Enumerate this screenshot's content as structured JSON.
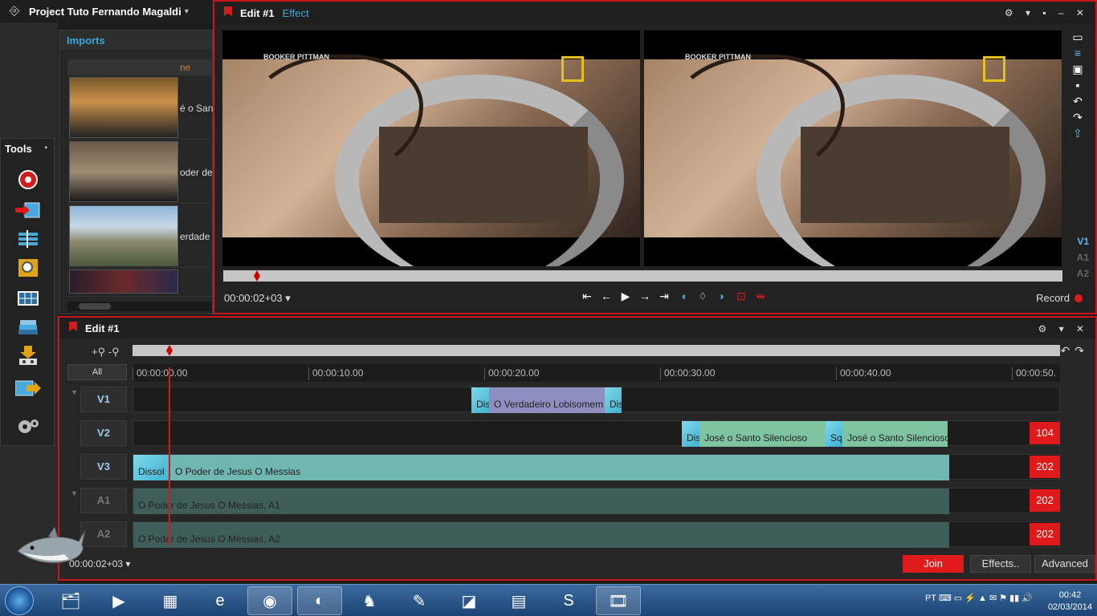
{
  "project": {
    "title": "Project Tuto Fernando Magaldi",
    "caret": "▾",
    "exit_icon": "exit-icon"
  },
  "imports": {
    "title": "Imports",
    "col_header": "ne",
    "items": [
      {
        "label": "é o San"
      },
      {
        "label": "oder de"
      },
      {
        "label": "erdade"
      },
      {
        "label": ""
      }
    ]
  },
  "tools": {
    "title": "Tools",
    "pin": "▪"
  },
  "viewer": {
    "title": "Edit #1",
    "subtitle": "Effect",
    "watermark": "BOOKER PITTMAN",
    "timecode": "00:00:02+03",
    "timecode_caret": "▾",
    "record_label": "Record",
    "tracks": [
      "V1",
      "A1",
      "A2"
    ]
  },
  "timeline": {
    "title": "Edit #1",
    "zoom_in": "+",
    "zoom_out": "-",
    "all_label": "All",
    "ruler": [
      "00:00:00.00",
      "00:00:10.00",
      "00:00:20.00",
      "00:00:30.00",
      "00:00:40.00",
      "00:00:50."
    ],
    "tracks": [
      {
        "name": "V1",
        "badge": ""
      },
      {
        "name": "V2",
        "badge": "104"
      },
      {
        "name": "V3",
        "badge": "202"
      },
      {
        "name": "A1",
        "badge": "202"
      },
      {
        "name": "A2",
        "badge": "202"
      }
    ],
    "clips": {
      "v1_t1": "Dis",
      "v1_main": "O Verdadeiro Lobisomem",
      "v1_t2": "Dis",
      "v2_t1": "Dis",
      "v2_main1": "José o Santo Silencioso",
      "v2_t2": "Sq",
      "v2_main2": "José o Santo Silencioso",
      "v3_t": "Dissol",
      "v3_main": "O Poder de Jesus   O Messias",
      "a1": "O Poder de Jesus   O Messias, A1",
      "a2": "O Poder de Jesus   O Messias, A2"
    },
    "timecode": "00:00:02+03",
    "timecode_caret": "▾",
    "join_label": "Join",
    "effects_label": "Effects..",
    "advanced_label": "Advanced"
  },
  "taskbar": {
    "lang": "PT",
    "time": "00:42",
    "date": "02/03/2014"
  },
  "colors": {
    "accent_red": "#c8161d",
    "accent_blue": "#3ba7d9",
    "clip_green": "#7fc4a0",
    "clip_purple": "#8e8fc0",
    "clip_teal": "#6fb7b0"
  }
}
